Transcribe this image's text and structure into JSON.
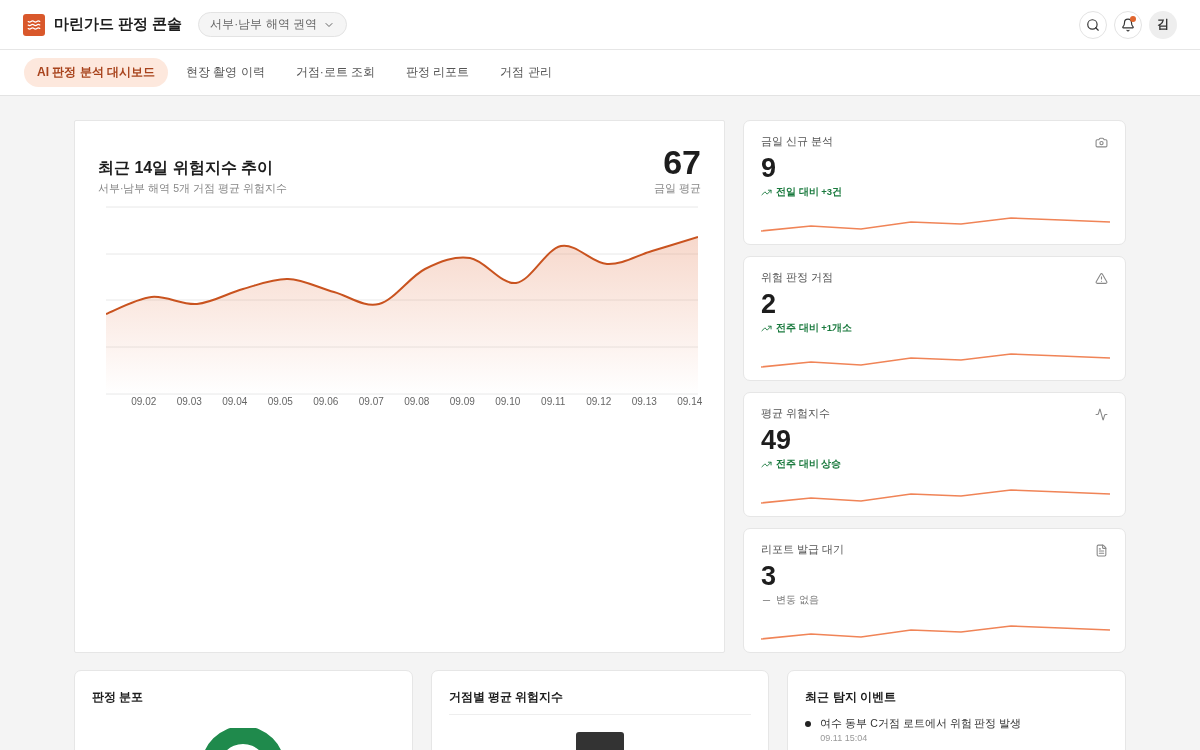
{
  "app": {
    "title": "마린가드 판정 콘솔",
    "region": "서부·남부 해역 권역",
    "avatar": "김",
    "notification": true
  },
  "tabs": [
    {
      "label": "AI 판정 분석 대시보드",
      "selected": true
    },
    {
      "label": "현장 촬영 이력",
      "selected": false
    },
    {
      "label": "거점·로트 조회",
      "selected": false
    },
    {
      "label": "판정 리포트",
      "selected": false
    },
    {
      "label": "거점 관리",
      "selected": false
    }
  ],
  "trend": {
    "title": "최근 14일 위험지수 추이",
    "subtitle": "서부·남부 해역 5개 거점 평균 위험지수",
    "value": "67",
    "value_label": "금일 평균",
    "x_labels": [
      "09.02",
      "09.03",
      "09.04",
      "09.05",
      "09.06",
      "09.07",
      "09.08",
      "09.09",
      "09.10",
      "09.11",
      "09.12",
      "09.13",
      "09.14"
    ]
  },
  "stats": [
    {
      "kind": "up",
      "label": "금일 신규 분석",
      "value": "9",
      "change": "전일 대비 +3건"
    },
    {
      "kind": "up",
      "label": "위험 판정 거점",
      "value": "2",
      "change": "전주 대비 +1개소"
    },
    {
      "kind": "up",
      "label": "평균 위험지수",
      "value": "49",
      "change": "전주 대비 상승"
    },
    {
      "kind": "flat",
      "label": "리포트 발급 대기",
      "value": "3",
      "change": "변동 없음"
    }
  ],
  "panels": [
    {
      "title": "판정 분포",
      "kind": "donut"
    },
    {
      "title": "거점별 평균 위험지수",
      "kind": "bars"
    },
    {
      "title": "최근 탐지 이벤트",
      "kind": "events",
      "events": [
        {
          "text": "여수 동부 C거점 로트에서 위험 판정 발생",
          "time": "09.11 15:04"
        }
      ]
    }
  ]
}
